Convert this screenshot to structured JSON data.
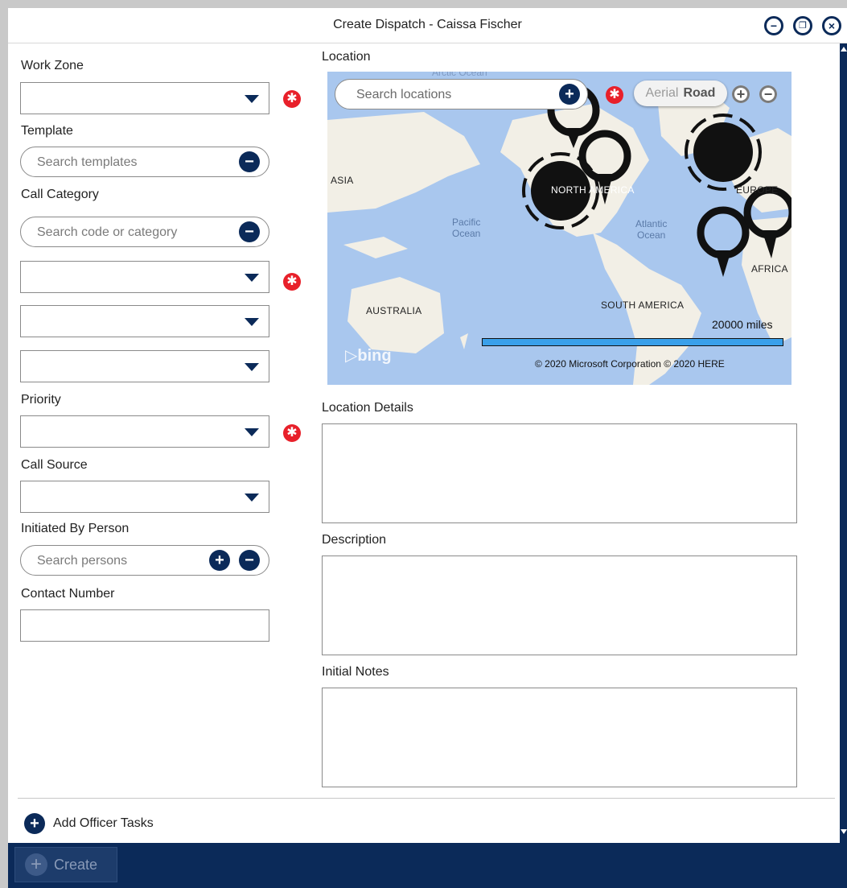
{
  "window": {
    "title": "Create Dispatch - Caissa Fischer"
  },
  "title_buttons": {
    "minimize_icon": "minus-circle-icon",
    "restore_icon": "restore-circle-icon",
    "close_icon": "close-circle-icon"
  },
  "left_form": {
    "work_zone": {
      "label": "Work Zone",
      "value": ""
    },
    "template": {
      "label": "Template",
      "placeholder": "Search templates"
    },
    "call_category": {
      "label": "Call Category",
      "placeholder": "Search code or category"
    },
    "category_dropdown_1": {
      "value": ""
    },
    "category_dropdown_2": {
      "value": ""
    },
    "category_dropdown_3": {
      "value": ""
    },
    "priority": {
      "label": "Priority",
      "value": ""
    },
    "call_source": {
      "label": "Call Source",
      "value": ""
    },
    "initiated_by": {
      "label": "Initiated By Person",
      "placeholder": "Search persons"
    },
    "contact_number": {
      "label": "Contact Number",
      "value": ""
    }
  },
  "location": {
    "label": "Location",
    "search_placeholder": "Search locations",
    "map": {
      "toggle_aerial": "Aerial",
      "toggle_road": "Road",
      "labels": {
        "asia": "ASIA",
        "australia": "AUSTRALIA",
        "south_america": "SOUTH AMERICA",
        "africa": "AFRICA",
        "europe": "EUROPE",
        "north_america": "NORTH AMERICA",
        "arctic": "Arctic Ocean"
      },
      "pacific": "Pacific\nOcean",
      "atlantic": "Atlantic\nOcean",
      "scale": "20000 miles",
      "copyright": "© 2020 Microsoft Corporation   © 2020 HERE",
      "provider": "bing"
    }
  },
  "location_details": {
    "label": "Location Details",
    "value": ""
  },
  "description": {
    "label": "Description",
    "value": ""
  },
  "initial_notes": {
    "label": "Initial Notes",
    "value": ""
  },
  "add_officer_tasks": "Add Officer Tasks",
  "footer": {
    "create_label": "Create"
  },
  "colors": {
    "navy": "#0b2a59",
    "required": "#e8202a",
    "map_water": "#a9c7ee",
    "map_land": "#f2efe6"
  }
}
